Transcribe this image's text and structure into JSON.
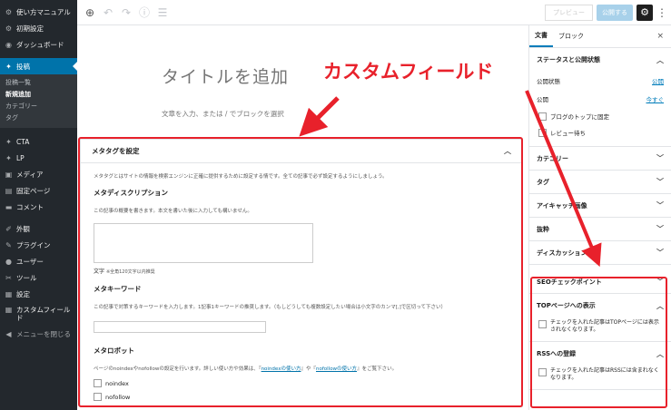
{
  "admin_menu": {
    "top": [
      {
        "icon": "gear-icon",
        "glyph": "⚙",
        "label": "使い方マニュアル"
      },
      {
        "icon": "gear-icon",
        "glyph": "⚙",
        "label": "初期設定"
      },
      {
        "icon": "dashboard-icon",
        "glyph": "◉",
        "label": "ダッシュボード"
      }
    ],
    "current": {
      "icon": "pin-icon",
      "glyph": "📌",
      "label": "投稿"
    },
    "submenu": [
      "投稿一覧",
      "新規追加",
      "カテゴリー",
      "タグ"
    ],
    "rest": [
      {
        "icon": "pin-icon",
        "glyph": "✎",
        "label": "CTA"
      },
      {
        "icon": "pin-icon",
        "glyph": "✎",
        "label": "LP"
      },
      {
        "icon": "media-icon",
        "glyph": "▣",
        "label": "メディア"
      },
      {
        "icon": "page-icon",
        "glyph": "▤",
        "label": "固定ページ"
      },
      {
        "icon": "comment-icon",
        "glyph": "▬",
        "label": "コメント"
      }
    ],
    "rest2": [
      {
        "icon": "appearance-icon",
        "glyph": "✐",
        "label": "外観"
      },
      {
        "icon": "plugin-icon",
        "glyph": "⚡",
        "label": "プラグイン"
      },
      {
        "icon": "user-icon",
        "glyph": "●",
        "label": "ユーザー"
      },
      {
        "icon": "tool-icon",
        "glyph": "✂",
        "label": "ツール"
      },
      {
        "icon": "settings-icon",
        "glyph": "▦",
        "label": "設定"
      },
      {
        "icon": "custom-field-icon",
        "glyph": "▦",
        "label": "カスタムフィールド"
      }
    ],
    "collapse": {
      "icon": "collapse-icon",
      "glyph": "◀",
      "label": "メニューを閉じる"
    }
  },
  "toolbar": {
    "preview_label": "プレビュー",
    "publish_label": "公開する"
  },
  "editor": {
    "title_placeholder": "タイトルを追加",
    "block_placeholder": "文章を入力、または / でブロックを選択"
  },
  "metabox": {
    "title": "メタタグを設定",
    "intro": "メタタグとはサイトの情報を検索エンジンに正確に提供するために設定する情です。全ての記事で必ず設定するようにしましょう。",
    "description": {
      "heading": "メタディスクリプション",
      "note": "この記事の概要を書きます。本文を書いた後に入力しても構いません。",
      "counter_label": "文字",
      "counter_note": "※全角120文字以内推奨"
    },
    "keyword": {
      "heading": "メタキーワード",
      "note": "この記事で対策するキーワードを入力します。1記事1キーワードの推奨します。（もしどうしても複数設定したい場合は小文字のカンマ[,]で区切って下さい）"
    },
    "robots": {
      "heading": "メタロボット",
      "note_pre": "ページのnoindexやnofollowの設定を行います。詳しい使い方や効果は、『",
      "link1": "noindexの使い方",
      "note_mid": "』や『",
      "link2": "nofollowの使い方",
      "note_post": "』をご覧下さい。",
      "options": [
        "noindex",
        "nofollow"
      ]
    }
  },
  "sidebar": {
    "tabs": [
      "文書",
      "ブロック"
    ],
    "close": "×",
    "status": {
      "heading": "ステータスと公開状態",
      "rows": [
        {
          "label": "公開状態",
          "value": "公開"
        },
        {
          "label": "公開",
          "value": "今すぐ"
        }
      ],
      "checks": [
        "ブログのトップに固定",
        "レビュー待ち"
      ]
    },
    "panels": [
      "カテゴリー",
      "タグ",
      "アイキャッチ画像",
      "抜粋",
      "ディスカッション"
    ],
    "custom_panels": {
      "seo": "SEOチェックポイント",
      "top": {
        "heading": "TOPページへの表示",
        "text": "チェックを入れた記事はTOPページには表示されなくなります。"
      },
      "rss": {
        "heading": "RSSへの登録",
        "text": "チェックを入れた記事はRSSには含まれなくなります。"
      }
    }
  },
  "annotation": {
    "label": "カスタムフィールド",
    "color": "#e8212b"
  }
}
